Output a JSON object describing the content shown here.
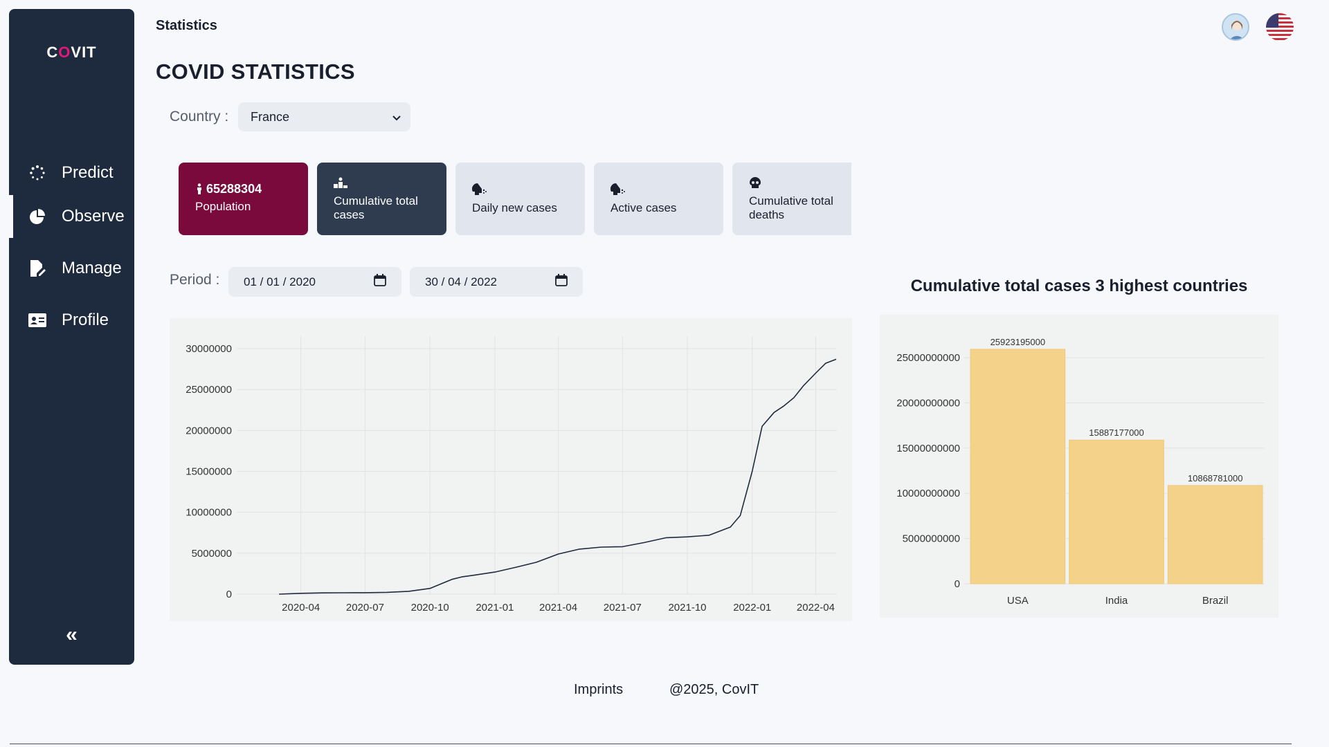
{
  "app": {
    "logo": "COVIT",
    "logo_pre": "C",
    "logo_o": "O",
    "logo_post": "VIT"
  },
  "sidebar": {
    "items": [
      {
        "label": "Predict",
        "icon": "spinner-dots-icon"
      },
      {
        "label": "Observe",
        "icon": "pie-chart-icon",
        "active": true
      },
      {
        "label": "Manage",
        "icon": "file-edit-icon"
      },
      {
        "label": "Profile",
        "icon": "id-card-icon"
      }
    ],
    "collapse": "«"
  },
  "header": {
    "breadcrumb": "Statistics",
    "title": "COVID STATISTICS"
  },
  "filters": {
    "country_label": "Country :",
    "country_value": "France",
    "period_label": "Period :",
    "date_from": "01 / 01 / 2020",
    "date_to": "30 / 04 / 2022"
  },
  "cards": [
    {
      "value": "65288304",
      "label": "Population",
      "style": "pop"
    },
    {
      "label": "Cumulative total cases",
      "style": "dark"
    },
    {
      "label": "Daily new cases",
      "style": "light"
    },
    {
      "label": "Active cases",
      "style": "light"
    },
    {
      "label": "Cumulative total deaths",
      "style": "light"
    }
  ],
  "colors": {
    "sidebar": "#1e2a3d",
    "accent": "#7b0a3c",
    "selected": "#2f3b4f",
    "bar": "#f4d28a",
    "line": "#1e2a3d"
  },
  "chart_data": [
    {
      "type": "line",
      "title": "",
      "xlabel": "",
      "ylabel": "",
      "ylim": [
        0,
        30000000
      ],
      "y_ticks": [
        "30000000",
        "25000000",
        "20000000",
        "15000000",
        "10000000",
        "5000000",
        "0"
      ],
      "x_ticks": [
        "2020-04",
        "2020-07",
        "2020-10",
        "2021-01",
        "2021-04",
        "2021-07",
        "2021-10",
        "2022-01",
        "2022-04"
      ],
      "grid": true,
      "x": [
        "2020-03-01",
        "2020-04-01",
        "2020-05-01",
        "2020-06-01",
        "2020-07-01",
        "2020-08-01",
        "2020-09-01",
        "2020-10-01",
        "2020-11-01",
        "2020-11-15",
        "2020-12-01",
        "2021-01-01",
        "2021-02-01",
        "2021-03-01",
        "2021-04-01",
        "2021-05-01",
        "2021-06-01",
        "2021-07-01",
        "2021-08-01",
        "2021-09-01",
        "2021-10-01",
        "2021-11-01",
        "2021-12-01",
        "2021-12-15",
        "2022-01-01",
        "2022-01-15",
        "2022-02-01",
        "2022-02-15",
        "2022-03-01",
        "2022-03-15",
        "2022-04-01",
        "2022-04-15",
        "2022-04-30"
      ],
      "values": [
        0,
        100000,
        150000,
        170000,
        180000,
        220000,
        350000,
        700000,
        1800000,
        2100000,
        2300000,
        2700000,
        3300000,
        3900000,
        4900000,
        5500000,
        5750000,
        5800000,
        6300000,
        6900000,
        7000000,
        7200000,
        8200000,
        9600000,
        15000000,
        20500000,
        22200000,
        23000000,
        24000000,
        25500000,
        27000000,
        28200000,
        28700000
      ]
    },
    {
      "type": "bar",
      "title": "Cumulative total cases 3 highest countries",
      "categories": [
        "USA",
        "India",
        "Brazil"
      ],
      "values": [
        25923195000,
        15887177000,
        10868781000
      ],
      "value_labels": [
        "25923195000",
        "15887177000",
        "10868781000"
      ],
      "y_ticks": [
        "25000000000",
        "20000000000",
        "15000000000",
        "10000000000",
        "5000000000",
        "0"
      ],
      "ylim": [
        0,
        25923195000
      ],
      "grid": true
    }
  ],
  "footer": {
    "imprints": "Imprints",
    "copyright": "@2025, CovIT"
  }
}
